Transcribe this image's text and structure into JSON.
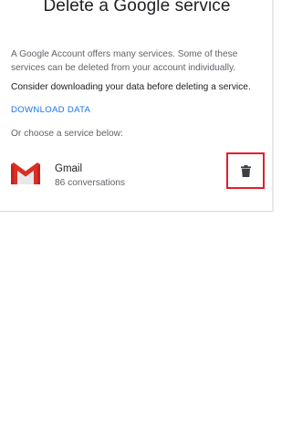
{
  "page": {
    "title": "Delete a Google service"
  },
  "content": {
    "intro": "A Google Account offers many services. Some of these services can be deleted from your account individually.",
    "consider": "Consider downloading your data before deleting a service.",
    "download_link": "DOWNLOAD DATA",
    "choose": "Or choose a service below:"
  },
  "services": [
    {
      "name": "Gmail",
      "meta": "86 conversations",
      "icon": "gmail-icon",
      "action_icon": "trash-icon"
    }
  ],
  "colors": {
    "link": "#1a73e8",
    "highlight_border": "#e41e2b",
    "gmail_red": "#d93025",
    "trash": "#3c4043"
  }
}
